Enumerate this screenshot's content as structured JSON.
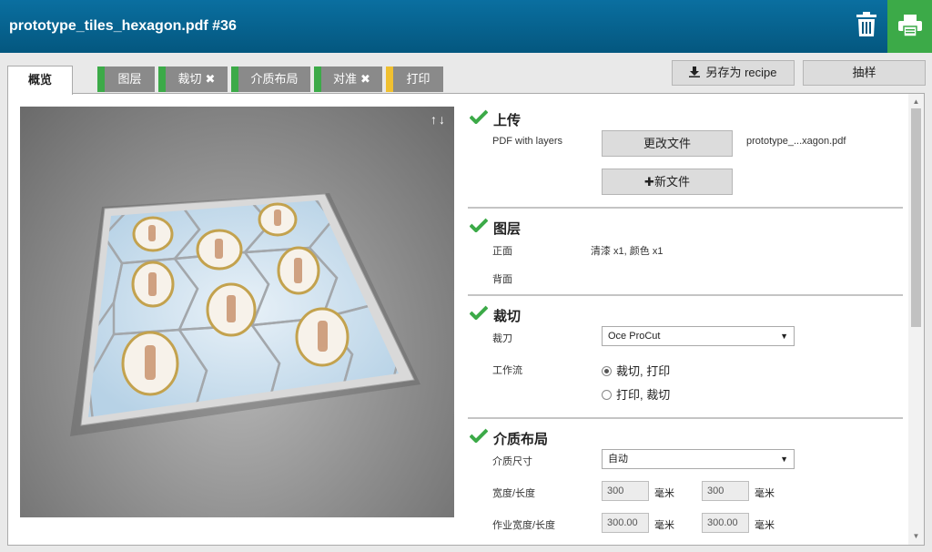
{
  "header": {
    "title": "prototype_tiles_hexagon.pdf #36"
  },
  "tabs": {
    "active": "概览",
    "items": [
      {
        "label": "图层",
        "x": false,
        "bar": "#3caa48"
      },
      {
        "label": "裁切",
        "x": true,
        "bar": "#3caa48"
      },
      {
        "label": "介质布局",
        "x": false,
        "bar": "#3caa48"
      },
      {
        "label": "对准",
        "x": true,
        "bar": "#3caa48"
      },
      {
        "label": "打印",
        "x": false,
        "bar": "#f0c030"
      }
    ],
    "x_glyph": "✖"
  },
  "actions": {
    "save_recipe": "另存为 recipe",
    "sample": "抽样"
  },
  "preview": {
    "arrows": "↑↓"
  },
  "sections": {
    "upload": {
      "title": "上传",
      "label": "PDF with layers",
      "change_file": "更改文件",
      "filename": "prototype_...xagon.pdf",
      "new_file": "新文件"
    },
    "layers": {
      "title": "图层",
      "front_label": "正面",
      "front_value": "清漆 x1, 颜色 x1",
      "back_label": "背面"
    },
    "cut": {
      "title": "裁切",
      "cutter_label": "裁刀",
      "cutter_value": "Oce ProCut",
      "workflow_label": "工作流",
      "workflow_options": [
        "裁切, 打印",
        "打印, 裁切"
      ],
      "workflow_selected": 0
    },
    "media": {
      "title": "介质布局",
      "size_label": "介质尺寸",
      "size_value": "自动",
      "wl_label": "宽度/长度",
      "width": "300",
      "length": "300",
      "job_wl_label": "作业宽度/长度",
      "job_width": "300.00",
      "job_length": "300.00",
      "unit": "毫米"
    }
  },
  "colors": {
    "header": "#04577f",
    "accent_green": "#3caa48",
    "accent_yellow": "#f0c030"
  }
}
